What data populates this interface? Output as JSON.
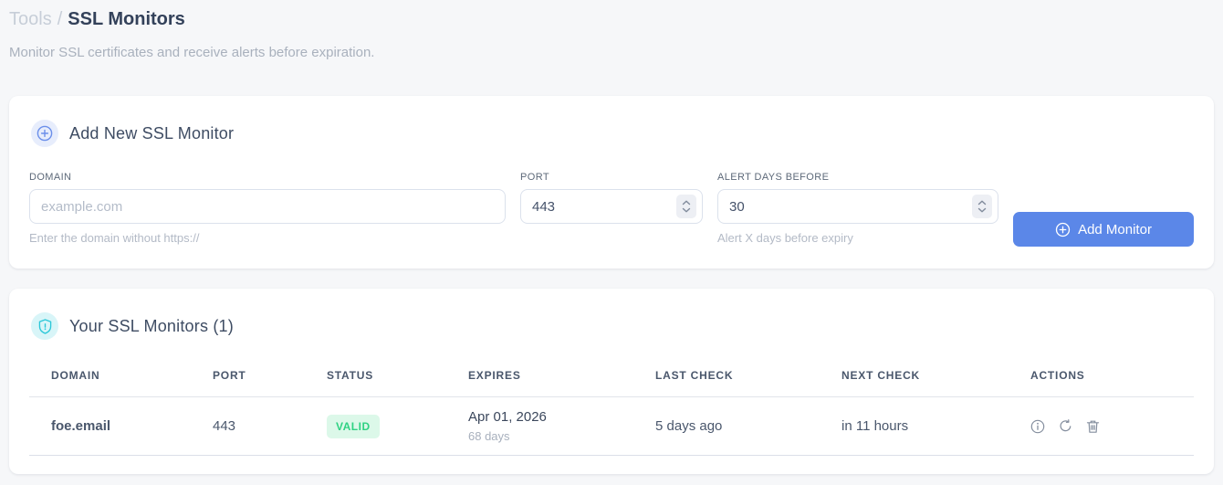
{
  "breadcrumb": {
    "section": "Tools",
    "separator": "/",
    "page": "SSL Monitors"
  },
  "subtitle": "Monitor SSL certificates and receive alerts before expiration.",
  "add_monitor_card": {
    "icon": "plus-circle-icon",
    "title": "Add New SSL Monitor",
    "fields": {
      "domain": {
        "label": "DOMAIN",
        "placeholder": "example.com",
        "value": "",
        "helper": "Enter the domain without https://"
      },
      "port": {
        "label": "PORT",
        "value": "443"
      },
      "alert_days": {
        "label": "ALERT DAYS BEFORE",
        "value": "30",
        "helper": "Alert X days before expiry"
      }
    },
    "submit": {
      "icon": "plus-circle-icon",
      "label": "Add Monitor"
    }
  },
  "monitors_card": {
    "icon": "shield-icon",
    "title": "Your SSL Monitors (1)",
    "table": {
      "headers": [
        "DOMAIN",
        "PORT",
        "STATUS",
        "EXPIRES",
        "LAST CHECK",
        "NEXT CHECK",
        "ACTIONS"
      ],
      "rows": [
        {
          "domain": "foe.email",
          "port": "443",
          "status": "VALID",
          "status_color": "#2fd283",
          "status_bg": "#dcf8e9",
          "expires_date": "Apr 01, 2026",
          "expires_relative": "68 days",
          "last_check": "5 days ago",
          "next_check": "in 11 hours",
          "actions": [
            "info-icon",
            "refresh-icon",
            "trash-icon"
          ]
        }
      ]
    }
  },
  "colors": {
    "accent_blue": "#5b87e8",
    "valid_green": "#2fd283",
    "shield_cyan": "#2ac7d8",
    "page_background": "#f6f7f9"
  }
}
